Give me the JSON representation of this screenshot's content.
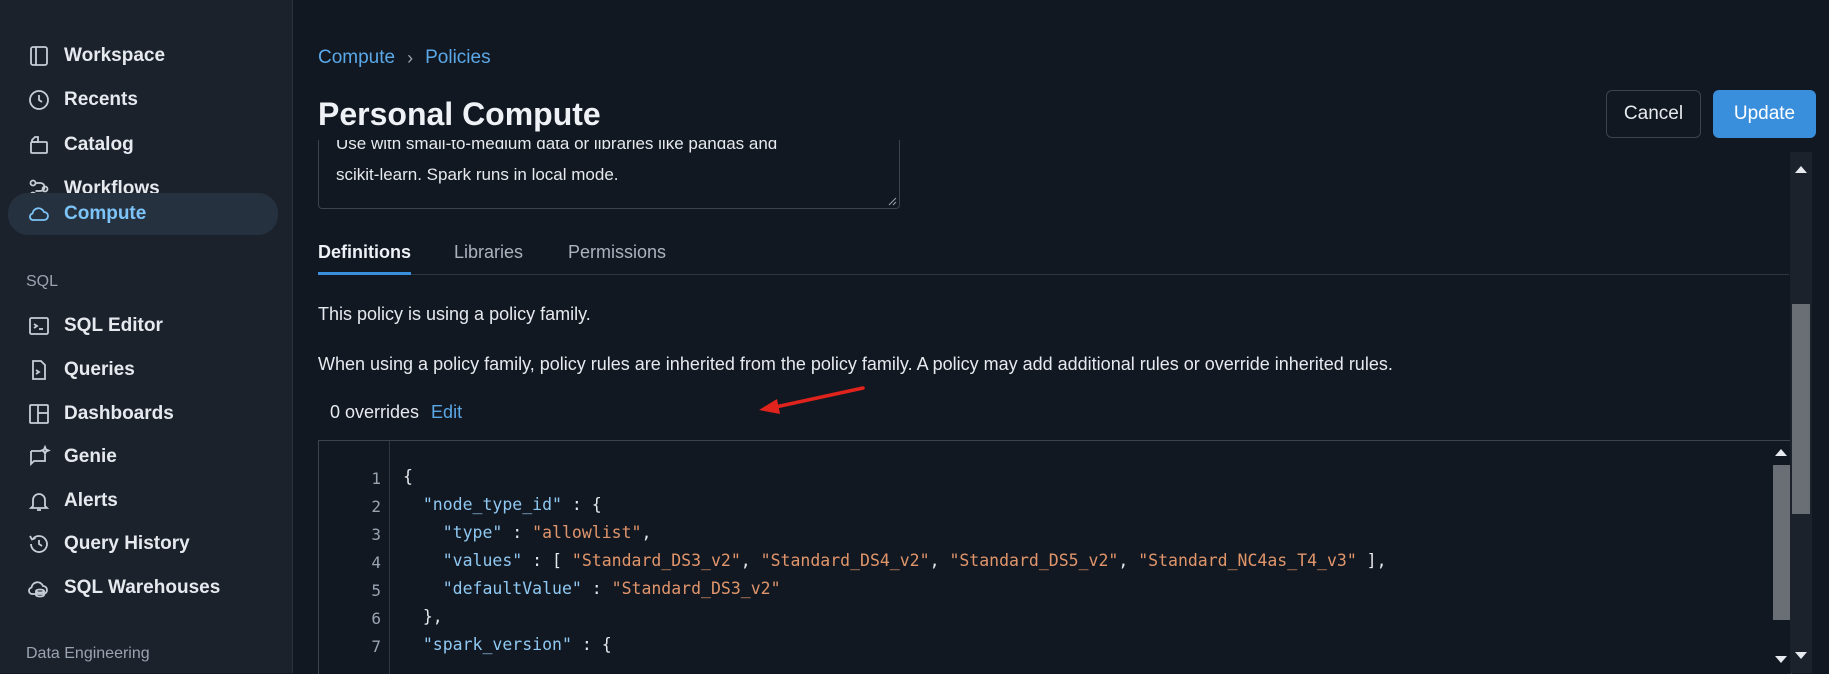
{
  "sidebar": {
    "items": [
      {
        "label": "Workspace",
        "icon": "workspace-icon"
      },
      {
        "label": "Recents",
        "icon": "clock-icon"
      },
      {
        "label": "Catalog",
        "icon": "catalog-icon"
      },
      {
        "label": "Workflows",
        "icon": "workflows-icon"
      },
      {
        "label": "Compute",
        "icon": "cloud-icon",
        "active": true
      }
    ],
    "sql_section_label": "SQL",
    "sql_items": [
      {
        "label": "SQL Editor",
        "icon": "sql-editor-icon"
      },
      {
        "label": "Queries",
        "icon": "queries-icon"
      },
      {
        "label": "Dashboards",
        "icon": "dashboards-icon"
      },
      {
        "label": "Genie",
        "icon": "genie-icon"
      },
      {
        "label": "Alerts",
        "icon": "bell-icon"
      },
      {
        "label": "Query History",
        "icon": "history-icon"
      },
      {
        "label": "SQL Warehouses",
        "icon": "warehouse-icon"
      }
    ],
    "data_engineering_label": "Data Engineering"
  },
  "breadcrumb": {
    "first": "Compute",
    "separator": "›",
    "second": "Policies"
  },
  "page": {
    "title": "Personal Compute"
  },
  "buttons": {
    "cancel": "Cancel",
    "update": "Update"
  },
  "description": {
    "line1": "Use with small-to-medium data or libraries like pandas and",
    "line2": "scikit-learn. Spark runs in local mode."
  },
  "tabs": [
    {
      "label": "Definitions",
      "active": true
    },
    {
      "label": "Libraries"
    },
    {
      "label": "Permissions"
    }
  ],
  "definitions": {
    "family_note": "This policy is using a policy family.",
    "inherit_note": "When using a policy family, policy rules are inherited from the policy family. A policy may add additional rules or override inherited rules.",
    "overrides_count": "0 overrides",
    "edit_label": "Edit"
  },
  "editor": {
    "line_numbers": [
      "1",
      "2",
      "3",
      "4",
      "5",
      "6",
      "7"
    ]
  },
  "colors": {
    "accent": "#3a8fdd",
    "link": "#5aa8e8",
    "annotation_arrow": "#e0231c",
    "json_key": "#8fc8f2",
    "json_string": "#e0956b"
  }
}
